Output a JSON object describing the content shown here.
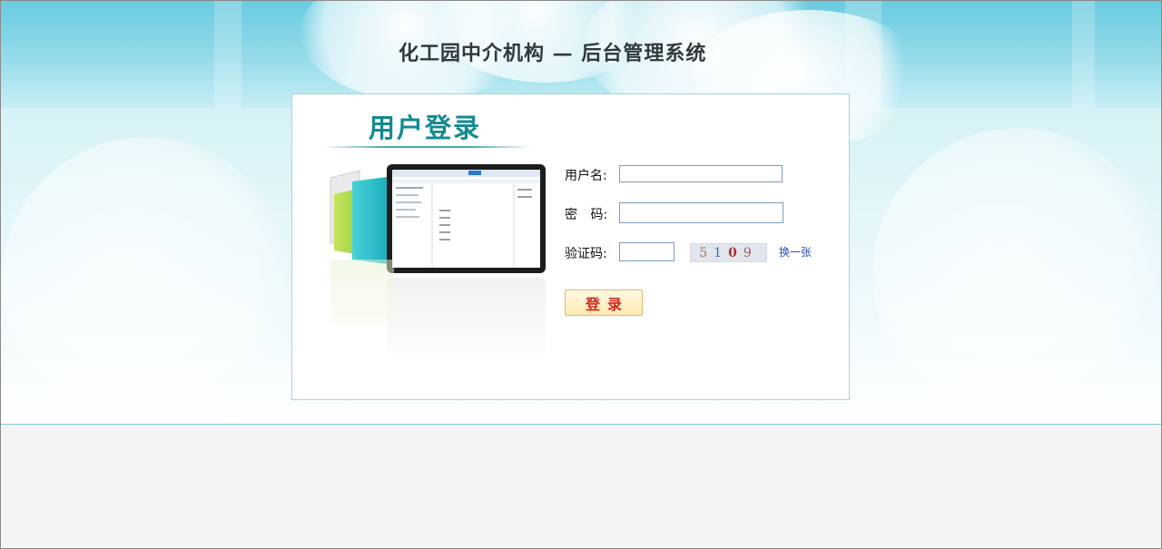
{
  "header": {
    "system_title": "化工园中介机构 — 后台管理系统"
  },
  "login_panel": {
    "title": "用户登录",
    "username_label": "用户名:",
    "password_label": "密 码:",
    "captcha_label": "验证码:",
    "username_value": "",
    "password_value": "",
    "captcha_value": "",
    "captcha_digits": [
      "5",
      "1",
      "0",
      "9"
    ],
    "refresh_captcha_label": "换一张",
    "login_button_label": "登录"
  },
  "colors": {
    "accent_teal": "#138a92",
    "link_blue": "#2a4fb9",
    "button_text_red": "#d0281c"
  }
}
